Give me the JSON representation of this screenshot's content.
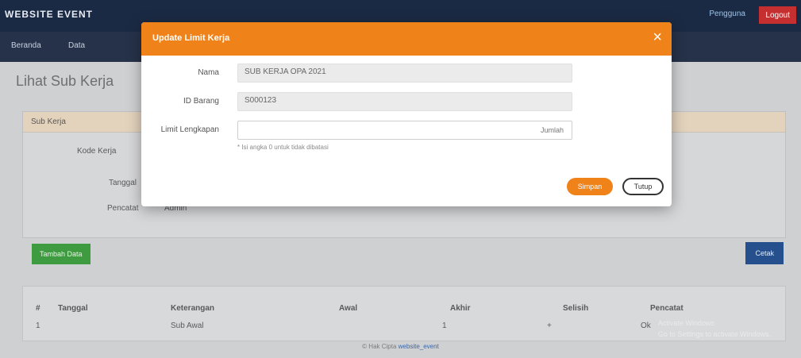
{
  "app": {
    "brand": "WEBSITE EVENT",
    "user": "Pengguna",
    "logout": "Logout"
  },
  "nav": {
    "items": [
      "Beranda",
      "Data"
    ]
  },
  "page": {
    "heading": "Lihat Sub Kerja"
  },
  "panel": {
    "header": "Sub Kerja",
    "rows": [
      {
        "label": "Kode Kerja",
        "value": ""
      },
      {
        "label": "Tanggal",
        "value": ""
      },
      {
        "label": "Pencatat",
        "value": "Admin"
      }
    ]
  },
  "buttons": {
    "add": "Tambah Data",
    "print": "Cetak"
  },
  "table": {
    "headers": [
      "#",
      "Tanggal",
      "Keterangan",
      "Awal",
      "Akhir",
      "Selisih",
      "Pencatat"
    ],
    "row": [
      "1",
      "",
      "Sub Awal",
      "",
      "1",
      "+",
      "Ok"
    ]
  },
  "footer": {
    "prefix": "© Hak Cipta",
    "link": "website_event"
  },
  "watermark": {
    "line1": "Activate Windows",
    "line2": "Go to Settings to activate Windows."
  },
  "modal": {
    "title": "Update Limit Kerja",
    "fields": [
      {
        "label": "Nama",
        "value": "SUB KERJA OPA 2021"
      },
      {
        "label": "ID Barang",
        "value": "S000123"
      },
      {
        "label": "Limit Lengkapan",
        "value": "",
        "unit": "Jumlah"
      }
    ],
    "hint": "* Isi angka 0 untuk tidak dibatasi",
    "save": "Simpan",
    "close": "Tutup"
  },
  "colors": {
    "accent": "#f0821a",
    "topbar": "#1b2a44",
    "danger": "#c62f2f",
    "success": "#3f9b3f",
    "primary": "#25508d"
  }
}
